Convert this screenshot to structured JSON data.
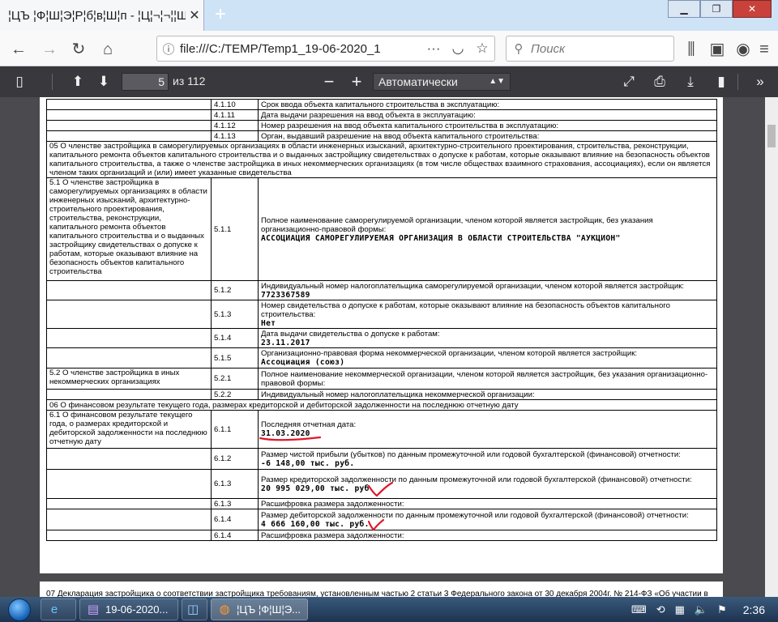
{
  "browser": {
    "tab_title": "¦ЦЪ ¦Ф¦Ш¦Э¦Р¦б¦в¦Ш¦п - ¦Ц¦¬¦¬¦¦Щ¦Ц¦Ш¦Р",
    "tab_close": "✕",
    "new_tab": "+",
    "window_buttons": [
      "▁",
      "❐",
      "✕"
    ],
    "url": "file:///C:/TEMP/Temp1_19-06-2020_1",
    "search_placeholder": "Поиск"
  },
  "pdf_toolbar": {
    "current_page": "5",
    "page_count": "из 112",
    "zoom": "Автоматически"
  },
  "document": {
    "rows": [
      {
        "c1": "",
        "c2": "4.1.10",
        "c3": "Срок ввода объекта капитального строительства в эксплуатацию:",
        "val": ""
      },
      {
        "c1": "",
        "c2": "4.1.11",
        "c3": "Дата выдачи разрешения на ввод объекта в эксплуатацию:",
        "val": ""
      },
      {
        "c1": "",
        "c2": "4.1.12",
        "c3": "Номер разрешения на ввод объекта капитального строительства в эксплуатацию:",
        "val": ""
      },
      {
        "c1": "",
        "c2": "4.1.13",
        "c3": "Орган, выдавший разрешение на ввод объекта капитального строительства:",
        "val": ""
      }
    ],
    "section05": "05 О членстве застройщика в саморегулируемых организациях в области инженерных изысканий, архитектурно-строительного проектирования, строительства, реконструкции, капитального ремонта объектов капитального строительства и о выданных застройщику свидетельствах о допуске к работам, которые оказывают влияние на безопасность объектов капитального строительства, а также о членстве застройщика в иных некоммерческих организациях (в том числе обществах взаимного страхования, ассоциациях), если он является членом таких организаций и (или) имеет указанные свидетельства",
    "s51_label": "5.1 О членстве застройщика в саморегулируемых организациях в области инженерных изысканий, архитектурно-строительного проектирования, строительства, реконструкции, капитального ремонта объектов капитального строительства и о выданных застройщику свидетельствах о допуске к работам, которые оказывают влияние на безопасность объектов капитального строительства",
    "r511_num": "5.1.1",
    "r511_text": "Полное наименование саморегулируемой организации, членом которой является застройщик, без указания организационно-правовой формы:",
    "r511_val": "АССОЦИАЦИЯ САМОРЕГУЛИРУЕМАЯ ОРГАНИЗАЦИЯ В ОБЛАСТИ СТРОИТЕЛЬСТВА \"АУКЦИОН\"",
    "r512_num": "5.1.2",
    "r512_text": "Индивидуальный номер налогоплательщика саморегулируемой организации, членом которой является застройщик:",
    "r512_val": "7723367589",
    "r513_num": "5.1.3",
    "r513_text": "Номер свидетельства о допуске к работам, которые оказывают влияние на безопасность объектов капитального строительства:",
    "r513_val": "Нет",
    "r514_num": "5.1.4",
    "r514_text": "Дата выдачи свидетельства о допуске к работам:",
    "r514_val": "23.11.2017",
    "r515_num": "5.1.5",
    "r515_text": "Организационно-правовая форма некоммерческой организации, членом которой является застройщик:",
    "r515_val": "Ассоциация (союз)",
    "s52_label": "5.2 О членстве застройщика в иных некоммерческих организациях",
    "r521_num": "5.2.1",
    "r521_text": "Полное наименование некоммерческой организации, членом которой является застройщик, без указания организационно-правовой формы:",
    "r522_num": "5.2.2",
    "r522_text": "Индивидуальный номер налогоплательщика некоммерческой организации:",
    "section06": "06 О финансовом результате текущего года, размерах кредиторской и дебиторской задолженности на последнюю отчетную дату",
    "s61_label": "6.1 О финансовом результате текущего года, о размерах кредиторской и дебиторской задолженности на последнюю отчетную дату",
    "r611_num": "6.1.1",
    "r611_text": "Последняя отчетная дата:",
    "r611_val": "31.03.2020",
    "r612_num": "6.1.2",
    "r612_text": "Размер чистой прибыли (убытков) по данным промежуточной или годовой бухгалтерской (финансовой) отчетности:",
    "r612_val": "-6 148,00 тыс. руб.",
    "r613_num": "6.1.3",
    "r613_text": "Размер кредиторской задолженности по данным промежуточной или годовой бухгалтерской (финансовой) отчетности:",
    "r613_val": "20 995 029,00 тыс. руб.",
    "r613b_num": "6.1.3",
    "r613b_text": "Расшифровка размера задолженности:",
    "r614_num": "6.1.4",
    "r614_text": "Размер дебиторской задолженности по данным промежуточной или годовой бухгалтерской (финансовой) отчетности:",
    "r614_val": "4 666 160,00 тыс. руб.",
    "r614b_num": "6.1.4",
    "r614b_text": "Расшифровка размера задолженности:",
    "page2_text": "07 Декларация застройщика о соответствии застройщика требованиям, установленным частью 2 статьи 3 Федерального закона от 30 декабря 2004г. № 214-ФЗ «Об участии в"
  },
  "taskbar": {
    "items": [
      {
        "label": "19-06-2020..."
      },
      {
        "label": ""
      },
      {
        "label": "¦ЦЪ ¦Ф¦Ш¦Э..."
      }
    ],
    "clock": "2:36"
  },
  "colors": {
    "annotation": "#e0182a"
  }
}
